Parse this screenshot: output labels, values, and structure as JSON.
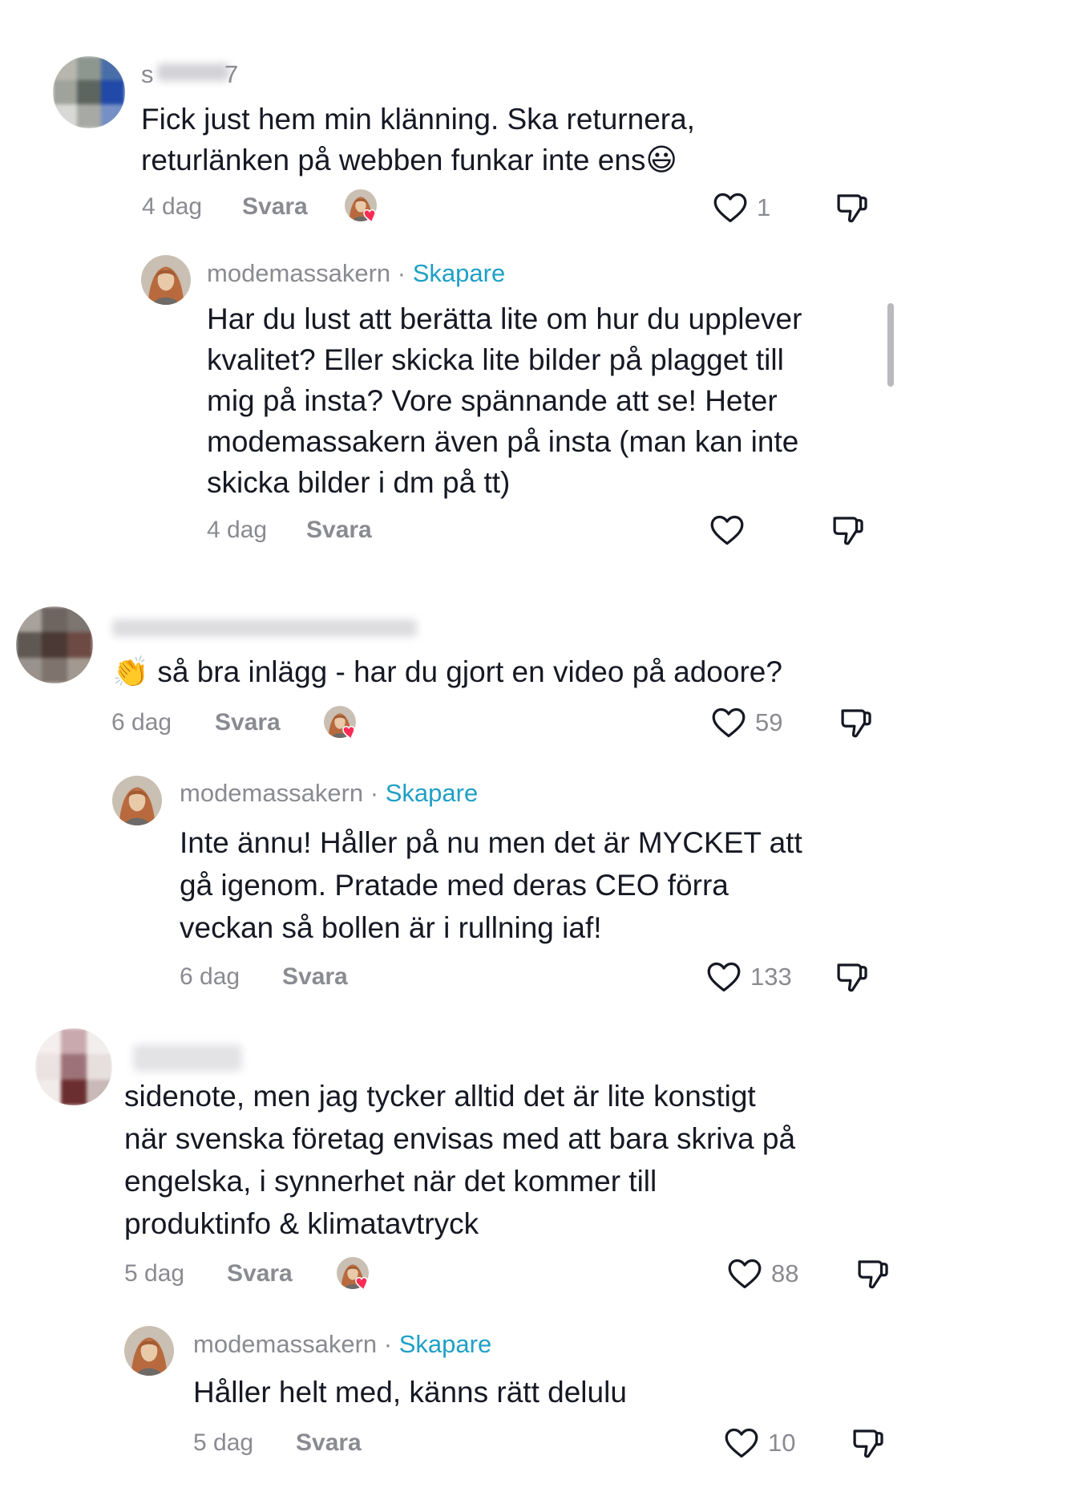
{
  "colors": {
    "muted": "#8a8b91",
    "creator": "#1fa0c6",
    "heart": "#fe2c55",
    "text": "#161823"
  },
  "comments": [
    {
      "username": "s",
      "username_tail": "7",
      "text_line1": "Fick just hem min klänning. Ska returnera,",
      "text_line2": "returlänken på webben funkar inte ens",
      "emoji": "😃",
      "date": "4 dag",
      "reply_label": "Svara",
      "likes": "1",
      "creator_liked": true,
      "reply": {
        "username": "modemassakern",
        "dot": "·",
        "badge": "Skapare",
        "lines": [
          "Har du lust att berätta lite om hur du upplever",
          "kvalitet? Eller skicka lite bilder på plagget till",
          "mig på insta? Vore spännande att se! Heter",
          "modemassakern även på insta (man kan inte",
          "skicka bilder i dm på tt)"
        ],
        "date": "4 dag",
        "reply_label": "Svara",
        "likes": ""
      }
    },
    {
      "username": "",
      "emoji": "👏",
      "text": "så bra inlägg - har du gjort en video på adoore?",
      "date": "6 dag",
      "reply_label": "Svara",
      "likes": "59",
      "creator_liked": true,
      "reply": {
        "username": "modemassakern",
        "dot": "·",
        "badge": "Skapare",
        "lines": [
          "Inte ännu! Håller på nu men det är MYCKET att",
          "gå igenom. Pratade med deras CEO förra",
          "veckan så bollen är i rullning iaf!"
        ],
        "date": "6 dag",
        "reply_label": "Svara",
        "likes": "133"
      }
    },
    {
      "username": "",
      "lines": [
        "sidenote, men jag tycker alltid det är lite konstigt",
        "när svenska företag envisas med att bara skriva på",
        "engelska, i synnerhet när det kommer till",
        "produktinfo & klimatavtryck"
      ],
      "date": "5 dag",
      "reply_label": "Svara",
      "likes": "88",
      "creator_liked": true,
      "reply": {
        "username": "modemassakern",
        "dot": "·",
        "badge": "Skapare",
        "lines": [
          "Håller helt med, känns rätt delulu"
        ],
        "date": "5 dag",
        "reply_label": "Svara",
        "likes": "10"
      }
    }
  ],
  "icons": {
    "like": "heart-outline-icon",
    "dislike": "thumbs-down-icon",
    "creator_liked": "creator-liked-heart-icon"
  }
}
